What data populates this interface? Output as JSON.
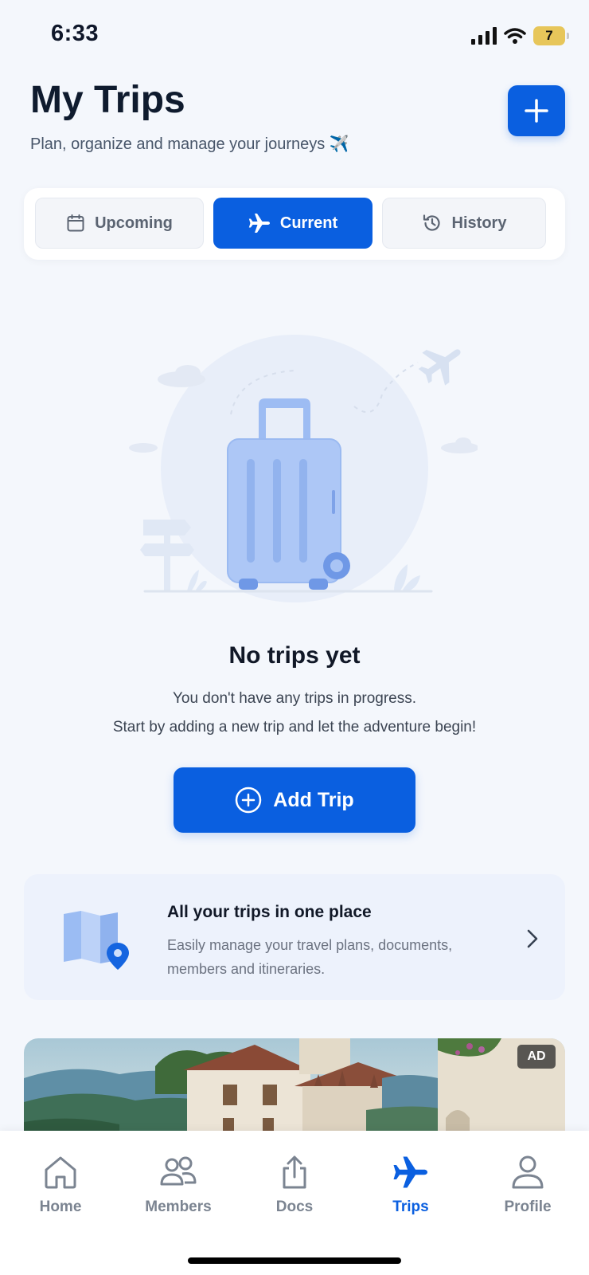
{
  "status_bar": {
    "time": "6:33",
    "battery": "7"
  },
  "header": {
    "title": "My Trips",
    "subtitle": "Plan, organize and manage your journeys ✈️",
    "add_icon": "plus-icon"
  },
  "tabs": [
    {
      "label": "Upcoming",
      "icon": "calendar-icon",
      "active": false
    },
    {
      "label": "Current",
      "icon": "airplane-icon",
      "active": true
    },
    {
      "label": "History",
      "icon": "history-icon",
      "active": false
    }
  ],
  "empty_state": {
    "title": "No trips yet",
    "line1": "You don't have any trips in progress.",
    "line2": "Start by adding a new trip and let the adventure begin!",
    "button_label": "Add Trip"
  },
  "info_card": {
    "title": "All your trips in one place",
    "description": "Easily manage your travel plans, documents, members and itineraries."
  },
  "ad": {
    "badge": "AD"
  },
  "bottom_nav": [
    {
      "label": "Home",
      "icon": "home-icon",
      "active": false
    },
    {
      "label": "Members",
      "icon": "members-icon",
      "active": false
    },
    {
      "label": "Docs",
      "icon": "share-upload-icon",
      "active": false
    },
    {
      "label": "Trips",
      "icon": "airplane-icon",
      "active": true
    },
    {
      "label": "Profile",
      "icon": "profile-icon",
      "active": false
    }
  ],
  "colors": {
    "accent": "#0a5fe0",
    "background": "#f4f7fc",
    "illustration": "#a9c4f5"
  }
}
